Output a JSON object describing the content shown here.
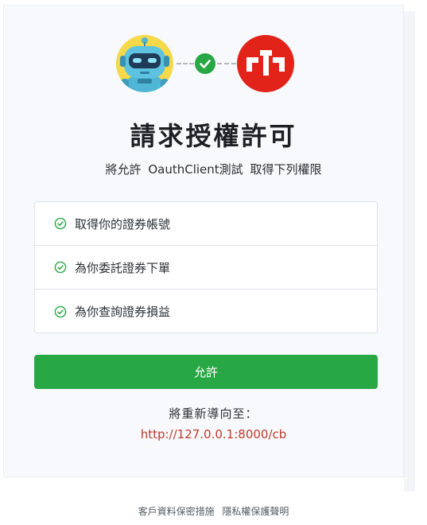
{
  "header": {
    "app_icon": "robot-icon",
    "connector_icon": "check-icon",
    "brand_icon": "brand-logo-icon",
    "accent_color": "#28a745",
    "brand_color": "#e2231a"
  },
  "title": "請求授權許可",
  "subtitle": {
    "prefix": "將允許",
    "client_name": "OauthClient測試",
    "suffix": "取得下列權限"
  },
  "permissions": [
    {
      "label": "取得你的證券帳號",
      "icon": "check-circle-icon"
    },
    {
      "label": "為你委託證券下單",
      "icon": "check-circle-icon"
    },
    {
      "label": "為你查詢證券損益",
      "icon": "check-circle-icon"
    }
  ],
  "allow_button": "允許",
  "redirect": {
    "label": "將重新導向至：",
    "url": "http://127.0.0.1:8000/cb",
    "color": "#c0392b"
  },
  "footer": {
    "privacy_measures": "客戶資料保密措施",
    "privacy_statement": "隱私權保護聲明"
  }
}
